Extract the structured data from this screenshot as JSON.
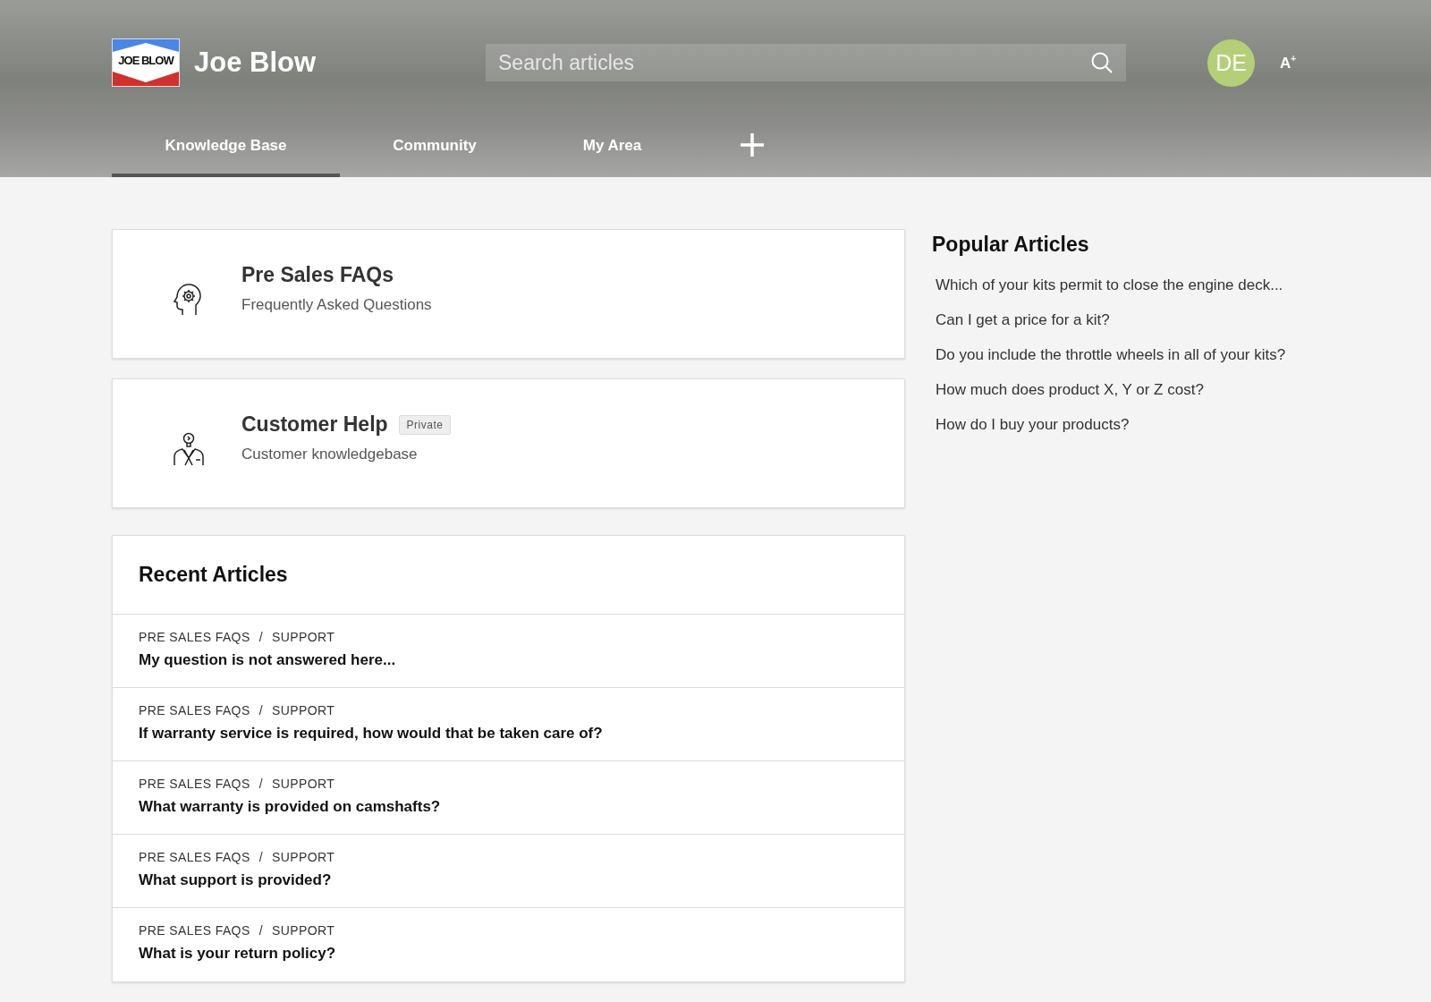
{
  "brand": {
    "logo_text": "JOE BLOW",
    "name": "Joe Blow"
  },
  "search": {
    "placeholder": "Search articles"
  },
  "user": {
    "initials": "DE"
  },
  "font_size_button": {
    "label": "A$^{+}$"
  },
  "tabs": [
    {
      "label": "Knowledge Base",
      "selected": true
    },
    {
      "label": "Community",
      "selected": false
    },
    {
      "label": "My Area",
      "selected": false
    }
  ],
  "categories": [
    {
      "kind": "head-gear",
      "title": "Pre Sales FAQs",
      "subtitle": "Frequently Asked Questions"
    },
    {
      "kind": "person-bulb",
      "title": "Customer Help",
      "badge": "Private",
      "subtitle": "Customer knowledgebase"
    }
  ],
  "recent_articles": {
    "title": "Recent Articles",
    "items": [
      {
        "category": "PRE SALES FAQS",
        "separator": "/",
        "section": "SUPPORT",
        "title": "My question is not answered here..."
      },
      {
        "category": "PRE SALES FAQS",
        "separator": "/",
        "section": "SUPPORT",
        "title": "If warranty service is required, how would that be taken care of?"
      },
      {
        "category": "PRE SALES FAQS",
        "separator": "/",
        "section": "SUPPORT",
        "title": "What warranty is provided on camshafts?"
      },
      {
        "category": "PRE SALES FAQS",
        "separator": "/",
        "section": "SUPPORT",
        "title": "What support is provided?"
      },
      {
        "category": "PRE SALES FAQS",
        "separator": "/",
        "section": "SUPPORT",
        "title": "What is your return policy?"
      }
    ]
  },
  "popular_articles": {
    "title": "Popular Articles",
    "items": [
      "Which of your kits permit to close the engine deck...",
      "Can I get a price for a kit?",
      "Do you include the throttle wheels in all of your kits?",
      "How much does product X, Y or Z cost?",
      "How do I buy your products?"
    ]
  }
}
